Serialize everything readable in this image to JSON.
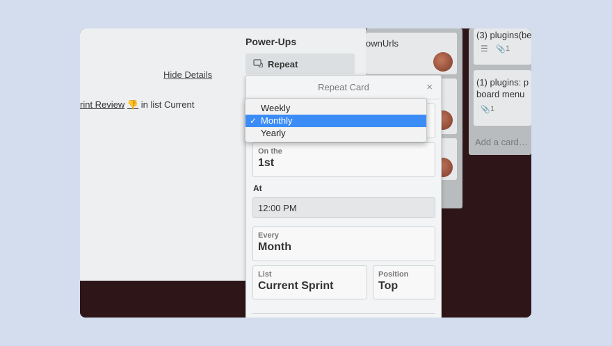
{
  "card_detail": {
    "hide_details": "Hide Details",
    "card_name": "rint Review",
    "card_emoji": "👎",
    "list_info": "in list Current"
  },
  "lists": {
    "card_a_fragment": "ownUrls",
    "card_b_line": "(3) plugins(be",
    "card_b_attach_count": "1",
    "card_c_line1": "(1) plugins: p",
    "card_c_line2": "board menu",
    "card_c_attach_count": "1",
    "add_card": "Add a card…"
  },
  "power_ups": {
    "title": "Power-Ups",
    "repeat_label": "Repeat"
  },
  "repeat_popover": {
    "title": "Repeat Card",
    "close_glyph": "×",
    "frequency_options": [
      "Weekly",
      "Monthly",
      "Yearly"
    ],
    "frequency_selected": "Monthly",
    "check_glyph": "✓",
    "on_the_label": "On the",
    "on_the_value": "1st",
    "at_label": "At",
    "time_value": "12:00 PM",
    "every_label": "Every",
    "every_value": "Month",
    "list_label": "List",
    "list_value": "Current Sprint",
    "position_label": "Position",
    "position_value": "Top"
  },
  "icons": {
    "repeat": "repeat-card-icon",
    "description": "description-lines-icon",
    "attachment": "paperclip-icon",
    "close": "close-icon",
    "check": "checkmark-icon"
  },
  "colors": {
    "page_bg": "#d3ddee",
    "selected_option": "#3b8cf6",
    "board_bg": "#2e1618"
  }
}
